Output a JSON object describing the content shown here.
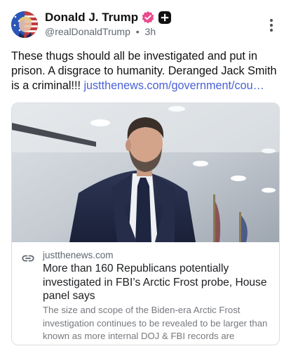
{
  "header": {
    "display_name": "Donald J. Trump",
    "handle": "@realDonaldTrump",
    "separator": "•",
    "timestamp": "3h",
    "icons": [
      "avatar",
      "verified-badge-icon",
      "plus-badge-icon",
      "more-options-icon"
    ]
  },
  "post": {
    "text": "These thugs should all be investigated and put in prison. A disgrace to humanity. Deranged Jack Smith is a criminal!!! ",
    "link_text": "justthenews.com/government/cou…"
  },
  "card": {
    "image_description_icon": "news-photo",
    "domain": "justthenews.com",
    "title": "More than 160 Republicans potentially investigated in FBI’s Arctic Frost probe, House panel says",
    "description": "The size and scope of the Biden-era Arctic Frost investigation continues to be revealed to be larger than known as more internal DOJ & FBI records are released."
  },
  "colors": {
    "link": "#4a61d6",
    "verified_badge": "#e94a8c",
    "secondary_text": "#606770"
  }
}
